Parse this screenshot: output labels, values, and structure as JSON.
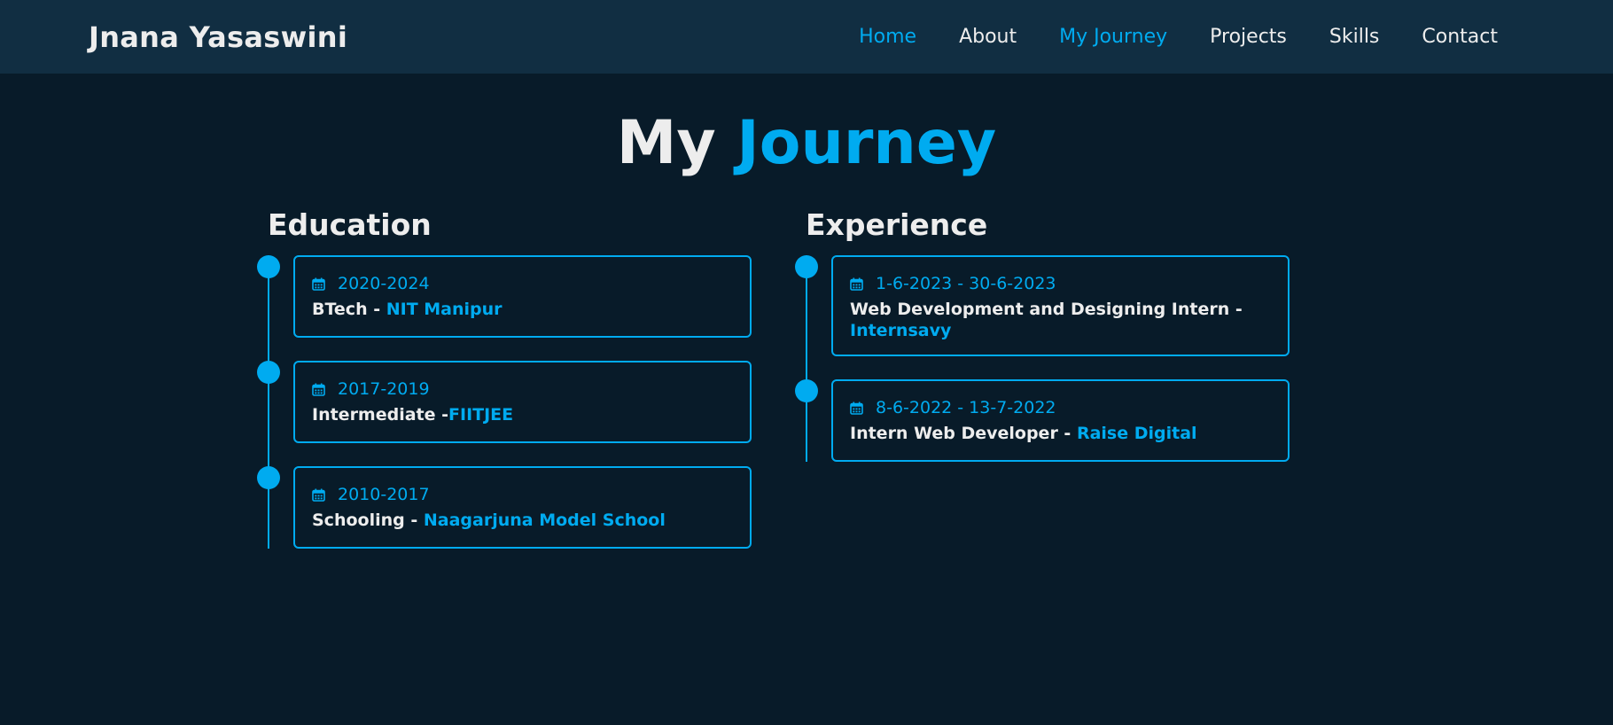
{
  "header": {
    "logo": "Jnana Yasaswini",
    "nav": [
      {
        "label": "Home",
        "active": true
      },
      {
        "label": "About",
        "active": false
      },
      {
        "label": "My Journey",
        "active": true
      },
      {
        "label": "Projects",
        "active": false
      },
      {
        "label": "Skills",
        "active": false
      },
      {
        "label": "Contact",
        "active": false
      }
    ]
  },
  "title": {
    "prefix": "My",
    "accent": "Journey"
  },
  "education": {
    "heading": "Education",
    "items": [
      {
        "date": "2020-2024",
        "title": "BTech - ",
        "org": "NIT Manipur"
      },
      {
        "date": "2017-2019",
        "title": "Intermediate -",
        "org": "FIITJEE"
      },
      {
        "date": "2010-2017",
        "title": "Schooling - ",
        "org": "Naagarjuna Model School"
      }
    ]
  },
  "experience": {
    "heading": "Experience",
    "items": [
      {
        "date": "1-6-2023 - 30-6-2023",
        "title": "Web Development and Designing Intern - ",
        "org": "Internsavy"
      },
      {
        "date": "8-6-2022 - 13-7-2022",
        "title": "Intern Web Developer - ",
        "org": "Raise Digital"
      }
    ]
  },
  "colors": {
    "accent": "#00abf0",
    "background": "#081b29",
    "header_bg": "#112e42",
    "text": "#ededed"
  },
  "icons": {
    "date_icon": "calendar-icon"
  }
}
